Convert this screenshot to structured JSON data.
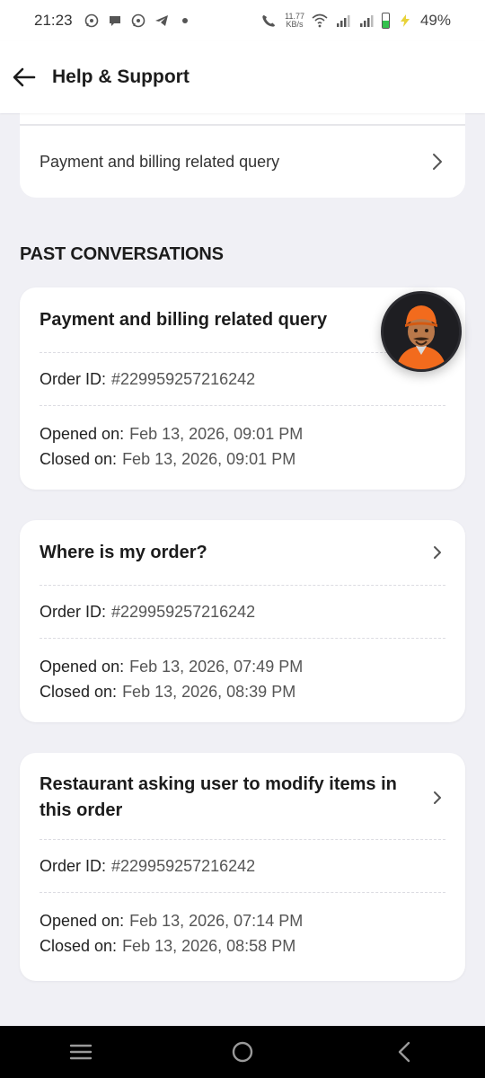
{
  "status_bar": {
    "time": "21:23",
    "net_speed_value": "11.77",
    "net_speed_unit": "KB/s",
    "battery_percent": "49%",
    "battery_level": 0.49,
    "notification_icons": [
      "whatsapp-icon",
      "chat-icon",
      "whatsapp-icon",
      "telegram-icon",
      "dot-icon"
    ]
  },
  "header": {
    "title": "Help & Support",
    "back_icon": "arrow-left-icon"
  },
  "top_card": {
    "label": "Payment and billing related query"
  },
  "past_conversations": {
    "section_title": "PAST CONVERSATIONS",
    "items": [
      {
        "title": "Payment and billing related query",
        "order_label": "Order ID:",
        "order_id": "#229959257216242",
        "opened_label": "Opened on:",
        "opened_value": "Feb 13, 2026, 09:01 PM",
        "closed_label": "Closed on:",
        "closed_value": "Feb 13, 2026, 09:01 PM"
      },
      {
        "title": "Where is my order?",
        "order_label": "Order ID:",
        "order_id": "#229959257216242",
        "opened_label": "Opened on:",
        "opened_value": "Feb 13, 2026, 07:49 PM",
        "closed_label": "Closed on:",
        "closed_value": "Feb 13, 2026, 08:39 PM"
      },
      {
        "title_line1": "Restaurant asking user to modify items in",
        "title_line2": "this order",
        "order_label": "Order ID:",
        "order_id": "#229959257216242",
        "opened_label": "Opened on:",
        "opened_value": "Feb 13, 2026, 07:14 PM",
        "closed_label": "Closed on:",
        "closed_value": "Feb 13, 2026, 08:58 PM"
      }
    ]
  },
  "colors": {
    "background": "#f0f0f5",
    "card": "#ffffff",
    "text_primary": "#1c1c1c",
    "text_secondary": "#555555",
    "avatar_orange": "#f26b1d",
    "battery_green": "#32c24d"
  }
}
